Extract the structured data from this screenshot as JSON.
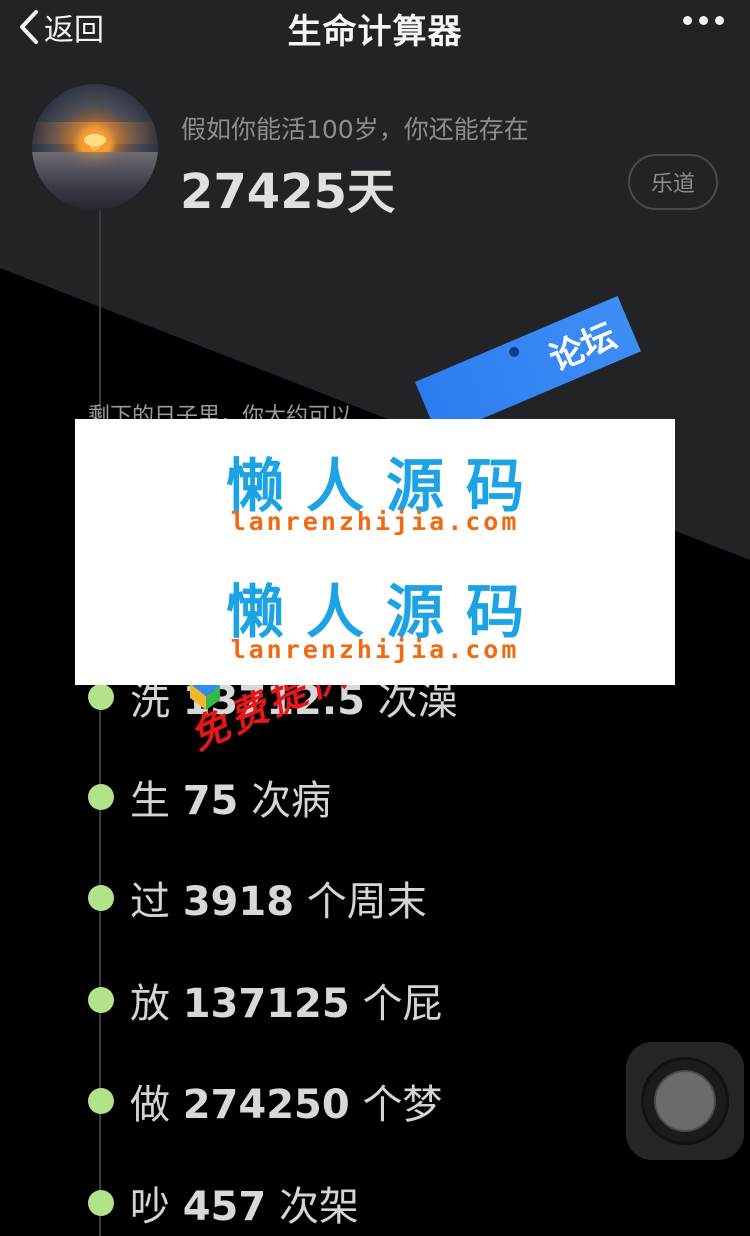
{
  "header": {
    "back_label": "返回",
    "title": "生命计算器"
  },
  "profile": {
    "subtitle": "假如你能活100岁，你还能存在",
    "days_value": "27425",
    "days_unit": "天",
    "tag_label": "乐道"
  },
  "intro_text": "剩下的日子里，你大约可以",
  "items": [
    {
      "verb": "洗",
      "value": "13712.5",
      "unit": "次澡"
    },
    {
      "verb": "生",
      "value": "75",
      "unit": "次病"
    },
    {
      "verb": "过",
      "value": "3918",
      "unit": "个周末"
    },
    {
      "verb": "放",
      "value": "137125",
      "unit": "个屁"
    },
    {
      "verb": "做",
      "value": "274250",
      "unit": "个梦"
    },
    {
      "verb": "吵",
      "value": "457",
      "unit": "次架"
    }
  ],
  "watermark": {
    "cn_line_1": "懒人源码",
    "en_line_1": "lanrenzhijia.com",
    "cn_line_2": "懒人源码",
    "en_line_2": "lanrenzhijia.com",
    "forum_tag": "论坛",
    "stamp_text": "免费提供精品源码"
  },
  "colors": {
    "accent_dot": "#b2e38a",
    "watermark_blue": "#1ba3e3",
    "watermark_orange": "#f06a11",
    "stamp_red": "#e81616"
  },
  "icons": {
    "back": "chevron-left-icon",
    "more": "more-horizontal-icon",
    "floating": "assistive-touch-icon"
  }
}
